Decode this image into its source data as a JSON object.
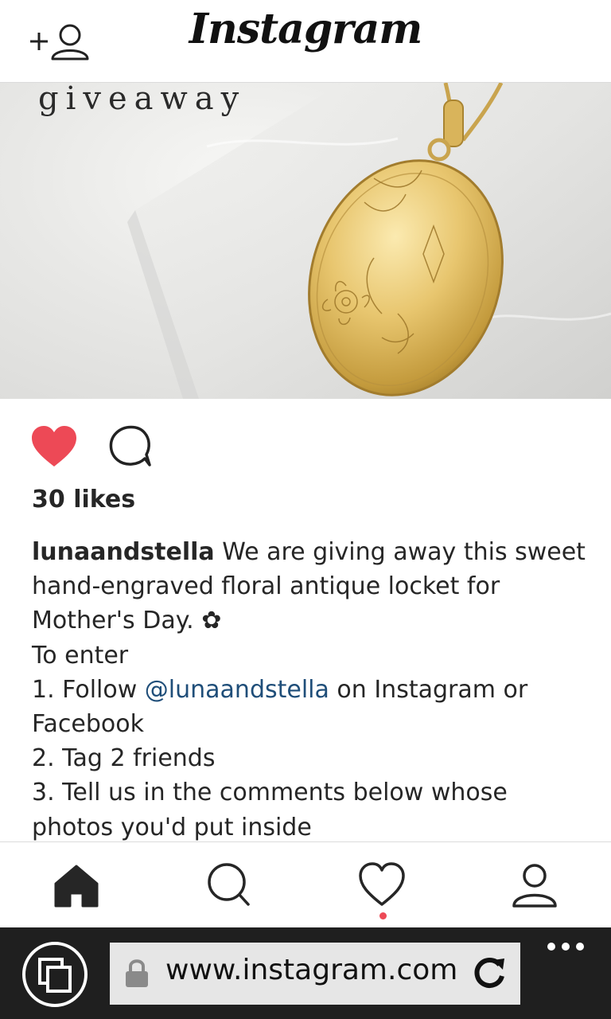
{
  "header": {
    "brand": "Instagram",
    "add_user_icon": "add-person-icon"
  },
  "post": {
    "image_overlay_text": "giveaway",
    "likes": "30 likes",
    "caption": {
      "username": "lunaandstella",
      "line1_rest": " We are giving away this sweet",
      "line2": "hand-engraved floral antique locket for",
      "line3_text": "Mother's Day. ",
      "line3_emoji": "✿",
      "line4": "To enter",
      "line5_prefix": "1. Follow ",
      "line5_mention": "@lunaandstella",
      "line5_suffix": " on Instagram or",
      "line6": "Facebook",
      "line7": "2. Tag 2 friends",
      "line8": "3. Tell us in the comments below whose",
      "line9": "photos you'd put inside"
    },
    "liked": true,
    "colors": {
      "like": "#ed4956",
      "mention": "#1f4e79"
    }
  },
  "bottom_nav": {
    "items": [
      "home-icon",
      "search-icon",
      "heart-icon",
      "profile-icon"
    ],
    "activity_dot": true
  },
  "browser": {
    "url": "www.instagram.com",
    "icons": [
      "tabs-icon",
      "lock-icon",
      "reload-icon",
      "more-icon"
    ]
  }
}
